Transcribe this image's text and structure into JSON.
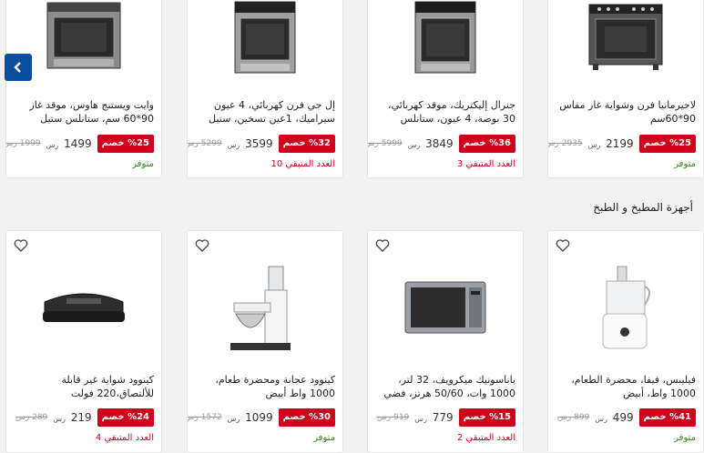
{
  "currency": "رس",
  "discount_suffix": "خصم",
  "section_title": "أجهزة المطبخ و الطبخ",
  "row1": [
    {
      "title": "لاجيرمانيا فرن وشواية غاز مقاس 90*60سم",
      "discount": "%25 خصم",
      "price": "2199",
      "old": "2935",
      "status": "متوفر",
      "status_type": "instock",
      "icon": "gas-range-icon"
    },
    {
      "title": "جنرال إليكتريك، موقد كهربائي، 30 بوصة، 4 عيون، ستانلس",
      "discount": "%36 خصم",
      "price": "3849",
      "old": "5999",
      "status": "العدد المتبقي 3",
      "status_type": "remain",
      "icon": "electric-range-icon"
    },
    {
      "title": "إل جي فرن كهربائي، 4 عيون سيراميك، 1عين تسخين، ستيل",
      "discount": "%32 خصم",
      "price": "3599",
      "old": "5299",
      "status": "العدد المتبقي 10",
      "status_type": "remain",
      "icon": "ceramic-range-icon"
    },
    {
      "title": "وايت ويستنج هاوس، موقد غاز 90*60 سم، ستانلس ستيل",
      "discount": "%25 خصم",
      "price": "1499",
      "old": "1999",
      "status": "متوفر",
      "status_type": "instock",
      "icon": "gas-stove-icon"
    }
  ],
  "row2": [
    {
      "title": "فيليبس، فيفا، محضرة الطعام، 1000 واط، أبيض",
      "discount": "%41 خصم",
      "price": "499",
      "old": "899",
      "status": "متوفر",
      "status_type": "instock",
      "icon": "food-processor-icon"
    },
    {
      "title": "باناسونيك ميكرويف، 32 لتر، 1000 وات، 50/60 هرتز، فضي",
      "discount": "%15 خصم",
      "price": "779",
      "old": "919",
      "status": "العدد المتبقي 2",
      "status_type": "remain",
      "icon": "microwave-icon"
    },
    {
      "title": "كينوود عجانة ومحضرة طعام، 1000 واط أبيض",
      "discount": "%30 خصم",
      "price": "1099",
      "old": "1572",
      "status": "متوفر",
      "status_type": "instock",
      "icon": "stand-mixer-icon"
    },
    {
      "title": "كينوود شواية غير قابلة للألتصاق،220 فولت",
      "discount": "%24 خصم",
      "price": "219",
      "old": "289",
      "status": "العدد المتبقي 4",
      "status_type": "remain",
      "icon": "electric-grill-icon"
    }
  ]
}
